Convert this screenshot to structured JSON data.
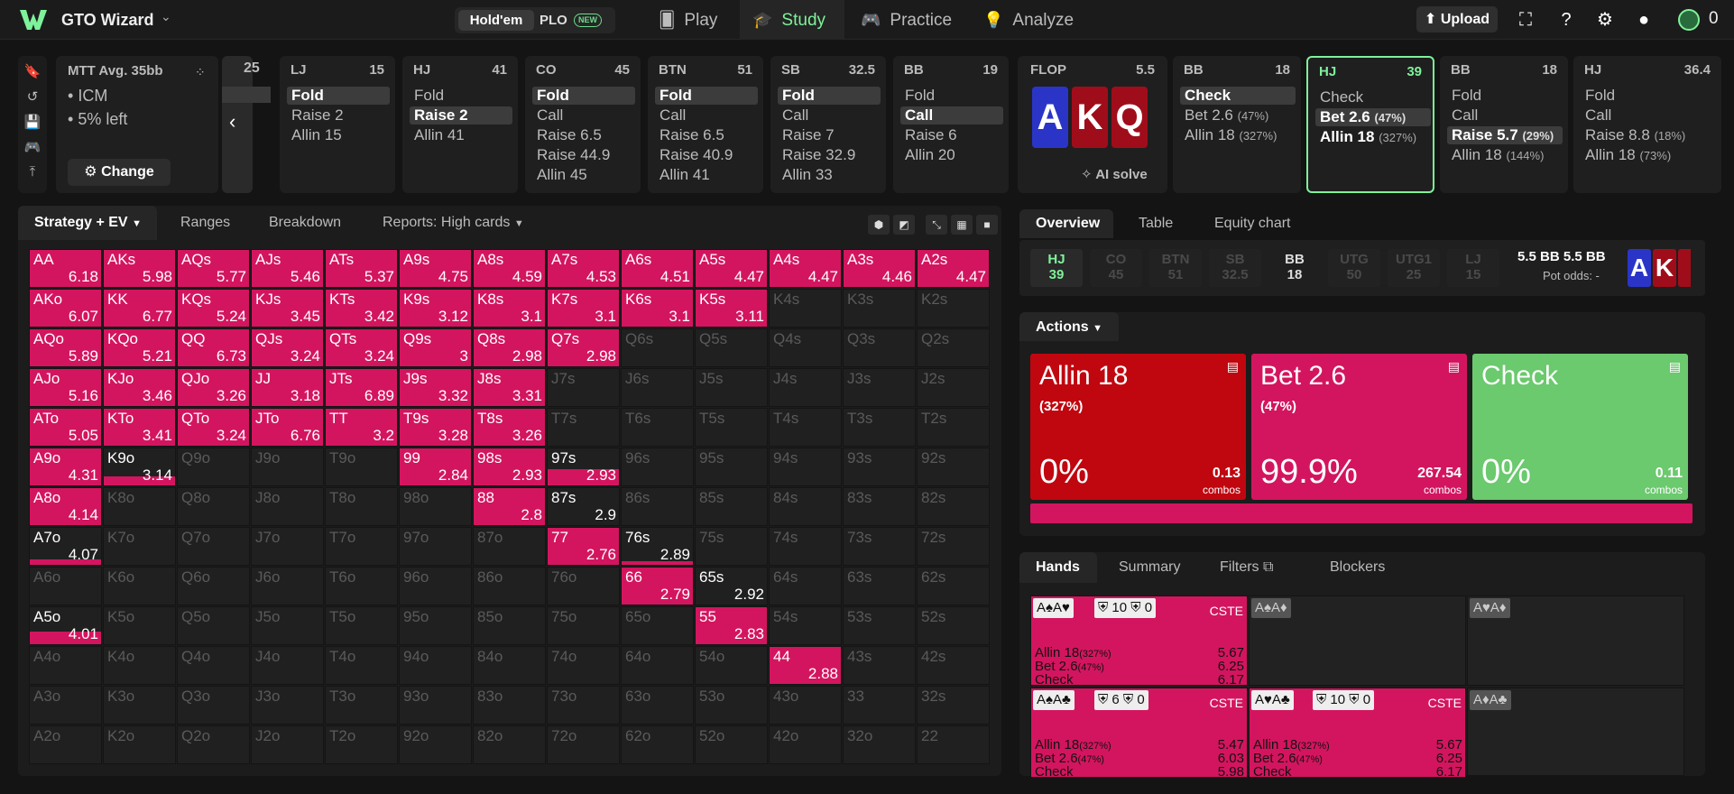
{
  "nav": {
    "brand": "GTO Wizard",
    "holdem": "Hold'em",
    "plo": "PLO",
    "new_badge": "NEW",
    "play": "Play",
    "study": "Study",
    "practice": "Practice",
    "analyze": "Analyze",
    "upload": "Upload",
    "credits": "0"
  },
  "mtt": {
    "title": "MTT  Avg. 35bb",
    "icm": "ICM",
    "left": "5% left",
    "change": "Change"
  },
  "prev": {
    "stack": "25"
  },
  "positions": [
    {
      "pos": "LJ",
      "stack": "15",
      "opts": [
        {
          "t": "Fold",
          "sel": true
        },
        {
          "t": "Raise 2"
        },
        {
          "t": "Allin 15"
        }
      ]
    },
    {
      "pos": "HJ",
      "stack": "41",
      "opts": [
        {
          "t": "Fold"
        },
        {
          "t": "Raise 2",
          "sel": true
        },
        {
          "t": "Allin 41"
        }
      ]
    },
    {
      "pos": "CO",
      "stack": "45",
      "opts": [
        {
          "t": "Fold",
          "sel": true
        },
        {
          "t": "Call"
        },
        {
          "t": "Raise 6.5"
        },
        {
          "t": "Raise 44.9"
        },
        {
          "t": "Allin 45"
        }
      ]
    },
    {
      "pos": "BTN",
      "stack": "51",
      "opts": [
        {
          "t": "Fold",
          "sel": true
        },
        {
          "t": "Call"
        },
        {
          "t": "Raise 6.5"
        },
        {
          "t": "Raise 40.9"
        },
        {
          "t": "Allin 41"
        }
      ]
    },
    {
      "pos": "SB",
      "stack": "32.5",
      "opts": [
        {
          "t": "Fold",
          "sel": true
        },
        {
          "t": "Call"
        },
        {
          "t": "Raise 7"
        },
        {
          "t": "Raise 32.9"
        },
        {
          "t": "Allin 33"
        }
      ]
    },
    {
      "pos": "BB",
      "stack": "19",
      "opts": [
        {
          "t": "Fold"
        },
        {
          "t": "Call",
          "sel": true
        },
        {
          "t": "Raise 6"
        },
        {
          "t": "Allin 20"
        }
      ]
    }
  ],
  "flop": {
    "label": "FLOP",
    "pot": "5.5",
    "cards": [
      "A",
      "K",
      "Q"
    ],
    "ai": "AI solve"
  },
  "postflop": [
    {
      "pos": "BB",
      "stack": "18",
      "opts": [
        {
          "t": "Check",
          "sel": true
        },
        {
          "t": "Bet 2.6",
          "p": "(47%)"
        },
        {
          "t": "Allin 18",
          "p": "(327%)"
        }
      ]
    },
    {
      "pos": "HJ",
      "stack": "39",
      "active": true,
      "opts": [
        {
          "t": "Check"
        },
        {
          "t": "Bet 2.6",
          "p": "(47%)",
          "sel": true
        },
        {
          "t": "Allin 18",
          "p": "(327%)",
          "bold": true
        }
      ]
    },
    {
      "pos": "BB",
      "stack": "18",
      "opts": [
        {
          "t": "Fold"
        },
        {
          "t": "Call"
        },
        {
          "t": "Raise 5.7",
          "p": "(29%)",
          "sel": true
        },
        {
          "t": "Allin 18",
          "p": "(144%)"
        }
      ]
    },
    {
      "pos": "HJ",
      "stack": "36.4",
      "opts": [
        {
          "t": "Fold"
        },
        {
          "t": "Call"
        },
        {
          "t": "Raise 8.8",
          "p": "(18%)"
        },
        {
          "t": "Allin 18",
          "p": "(73%)"
        }
      ]
    }
  ],
  "strategy_tabs": {
    "se": "Strategy + EV",
    "ranges": "Ranges",
    "breakdown": "Breakdown",
    "reports": "Reports: High cards"
  },
  "grid": [
    [
      [
        "AA",
        6.18,
        1
      ],
      [
        "AKs",
        5.98,
        1
      ],
      [
        "AQs",
        5.77,
        1
      ],
      [
        "AJs",
        5.46,
        1
      ],
      [
        "ATs",
        5.37,
        1
      ],
      [
        "A9s",
        4.75,
        1
      ],
      [
        "A8s",
        4.59,
        1
      ],
      [
        "A7s",
        4.53,
        1
      ],
      [
        "A6s",
        4.51,
        1
      ],
      [
        "A5s",
        4.47,
        1
      ],
      [
        "A4s",
        4.47,
        1
      ],
      [
        "A3s",
        4.46,
        1
      ],
      [
        "A2s",
        4.47,
        1
      ]
    ],
    [
      [
        "AKo",
        6.07,
        1
      ],
      [
        "KK",
        6.77,
        1
      ],
      [
        "KQs",
        5.24,
        1
      ],
      [
        "KJs",
        3.45,
        1
      ],
      [
        "KTs",
        3.42,
        1
      ],
      [
        "K9s",
        3.12,
        1
      ],
      [
        "K8s",
        3.1,
        1
      ],
      [
        "K7s",
        3.1,
        1
      ],
      [
        "K6s",
        3.1,
        1
      ],
      [
        "K5s",
        3.11,
        1
      ],
      [
        "K4s",
        null,
        0
      ],
      [
        "K3s",
        null,
        0
      ],
      [
        "K2s",
        null,
        0
      ]
    ],
    [
      [
        "AQo",
        5.89,
        1
      ],
      [
        "KQo",
        5.21,
        1
      ],
      [
        "QQ",
        6.73,
        1
      ],
      [
        "QJs",
        3.24,
        1
      ],
      [
        "QTs",
        3.24,
        1
      ],
      [
        "Q9s",
        3,
        1
      ],
      [
        "Q8s",
        2.98,
        1
      ],
      [
        "Q7s",
        2.98,
        1
      ],
      [
        "Q6s",
        null,
        0
      ],
      [
        "Q5s",
        null,
        0
      ],
      [
        "Q4s",
        null,
        0
      ],
      [
        "Q3s",
        null,
        0
      ],
      [
        "Q2s",
        null,
        0
      ]
    ],
    [
      [
        "AJo",
        5.16,
        1
      ],
      [
        "KJo",
        3.46,
        1
      ],
      [
        "QJo",
        3.26,
        1
      ],
      [
        "JJ",
        3.18,
        1
      ],
      [
        "JTs",
        6.89,
        1
      ],
      [
        "J9s",
        3.32,
        1
      ],
      [
        "J8s",
        3.31,
        1
      ],
      [
        "J7s",
        null,
        0
      ],
      [
        "J6s",
        null,
        0
      ],
      [
        "J5s",
        null,
        0
      ],
      [
        "J4s",
        null,
        0
      ],
      [
        "J3s",
        null,
        0
      ],
      [
        "J2s",
        null,
        0
      ]
    ],
    [
      [
        "ATo",
        5.05,
        1
      ],
      [
        "KTo",
        3.41,
        1
      ],
      [
        "QTo",
        3.24,
        1
      ],
      [
        "JTo",
        6.76,
        1
      ],
      [
        "TT",
        3.2,
        1
      ],
      [
        "T9s",
        3.28,
        1
      ],
      [
        "T8s",
        3.26,
        1
      ],
      [
        "T7s",
        null,
        0
      ],
      [
        "T6s",
        null,
        0
      ],
      [
        "T5s",
        null,
        0
      ],
      [
        "T4s",
        null,
        0
      ],
      [
        "T3s",
        null,
        0
      ],
      [
        "T2s",
        null,
        0
      ]
    ],
    [
      [
        "A9o",
        4.31,
        1
      ],
      [
        "K9o",
        3.14,
        0.25
      ],
      [
        "Q9o",
        null,
        0
      ],
      [
        "J9o",
        null,
        0
      ],
      [
        "T9o",
        null,
        0
      ],
      [
        "99",
        2.84,
        1
      ],
      [
        "98s",
        2.93,
        1
      ],
      [
        "97s",
        2.93,
        0.45
      ],
      [
        "96s",
        null,
        0
      ],
      [
        "95s",
        null,
        0
      ],
      [
        "94s",
        null,
        0
      ],
      [
        "93s",
        null,
        0
      ],
      [
        "92s",
        null,
        0
      ]
    ],
    [
      [
        "A8o",
        4.14,
        1
      ],
      [
        "K8o",
        null,
        0
      ],
      [
        "Q8o",
        null,
        0
      ],
      [
        "J8o",
        null,
        0
      ],
      [
        "T8o",
        null,
        0
      ],
      [
        "98o",
        null,
        0
      ],
      [
        "88",
        2.8,
        1
      ],
      [
        "87s",
        2.9,
        0
      ],
      [
        "86s",
        null,
        0
      ],
      [
        "85s",
        null,
        0
      ],
      [
        "84s",
        null,
        0
      ],
      [
        "83s",
        null,
        0
      ],
      [
        "82s",
        null,
        0
      ]
    ],
    [
      [
        "A7o",
        4.07,
        0.15
      ],
      [
        "K7o",
        null,
        0
      ],
      [
        "Q7o",
        null,
        0
      ],
      [
        "J7o",
        null,
        0
      ],
      [
        "T7o",
        null,
        0
      ],
      [
        "97o",
        null,
        0
      ],
      [
        "87o",
        null,
        0
      ],
      [
        "77",
        2.76,
        1
      ],
      [
        "76s",
        2.89,
        0.1
      ],
      [
        "75s",
        null,
        0
      ],
      [
        "74s",
        null,
        0
      ],
      [
        "73s",
        null,
        0
      ],
      [
        "72s",
        null,
        0
      ]
    ],
    [
      [
        "A6o",
        null,
        0
      ],
      [
        "K6o",
        null,
        0
      ],
      [
        "Q6o",
        null,
        0
      ],
      [
        "J6o",
        null,
        0
      ],
      [
        "T6o",
        null,
        0
      ],
      [
        "96o",
        null,
        0
      ],
      [
        "86o",
        null,
        0
      ],
      [
        "76o",
        null,
        0
      ],
      [
        "66",
        2.79,
        1
      ],
      [
        "65s",
        2.92,
        0
      ],
      [
        "64s",
        null,
        0
      ],
      [
        "63s",
        null,
        0
      ],
      [
        "62s",
        null,
        0
      ]
    ],
    [
      [
        "A5o",
        4.01,
        0.35
      ],
      [
        "K5o",
        null,
        0
      ],
      [
        "Q5o",
        null,
        0
      ],
      [
        "J5o",
        null,
        0
      ],
      [
        "T5o",
        null,
        0
      ],
      [
        "95o",
        null,
        0
      ],
      [
        "85o",
        null,
        0
      ],
      [
        "75o",
        null,
        0
      ],
      [
        "65o",
        null,
        0
      ],
      [
        "55",
        2.83,
        1
      ],
      [
        "54s",
        null,
        0
      ],
      [
        "53s",
        null,
        0
      ],
      [
        "52s",
        null,
        0
      ]
    ],
    [
      [
        "A4o",
        null,
        0
      ],
      [
        "K4o",
        null,
        0
      ],
      [
        "Q4o",
        null,
        0
      ],
      [
        "J4o",
        null,
        0
      ],
      [
        "T4o",
        null,
        0
      ],
      [
        "94o",
        null,
        0
      ],
      [
        "84o",
        null,
        0
      ],
      [
        "74o",
        null,
        0
      ],
      [
        "64o",
        null,
        0
      ],
      [
        "54o",
        null,
        0
      ],
      [
        "44",
        2.88,
        1
      ],
      [
        "43s",
        null,
        0
      ],
      [
        "42s",
        null,
        0
      ]
    ],
    [
      [
        "A3o",
        null,
        0
      ],
      [
        "K3o",
        null,
        0
      ],
      [
        "Q3o",
        null,
        0
      ],
      [
        "J3o",
        null,
        0
      ],
      [
        "T3o",
        null,
        0
      ],
      [
        "93o",
        null,
        0
      ],
      [
        "83o",
        null,
        0
      ],
      [
        "73o",
        null,
        0
      ],
      [
        "63o",
        null,
        0
      ],
      [
        "53o",
        null,
        0
      ],
      [
        "43o",
        null,
        0
      ],
      [
        "33",
        null,
        0
      ],
      [
        "32s",
        null,
        0
      ]
    ],
    [
      [
        "A2o",
        null,
        0
      ],
      [
        "K2o",
        null,
        0
      ],
      [
        "Q2o",
        null,
        0
      ],
      [
        "J2o",
        null,
        0
      ],
      [
        "T2o",
        null,
        0
      ],
      [
        "92o",
        null,
        0
      ],
      [
        "82o",
        null,
        0
      ],
      [
        "72o",
        null,
        0
      ],
      [
        "62o",
        null,
        0
      ],
      [
        "52o",
        null,
        0
      ],
      [
        "42o",
        null,
        0
      ],
      [
        "32o",
        null,
        0
      ],
      [
        "22",
        null,
        0
      ]
    ]
  ],
  "overview": {
    "tabs": [
      "Overview",
      "Table",
      "Equity chart"
    ],
    "strip": [
      {
        "pos": "HJ",
        "stack": "39",
        "state": "hj"
      },
      {
        "pos": "CO",
        "stack": "45",
        "state": "off"
      },
      {
        "pos": "BTN",
        "stack": "51",
        "state": "off"
      },
      {
        "pos": "SB",
        "stack": "32.5",
        "state": "off"
      },
      {
        "pos": "BB",
        "stack": "18",
        "state": "bb"
      },
      {
        "pos": "UTG",
        "stack": "50",
        "state": "off"
      },
      {
        "pos": "UTG1",
        "stack": "25",
        "state": "off"
      },
      {
        "pos": "LJ",
        "stack": "15",
        "state": "off"
      }
    ],
    "pot": "5.5 BB  5.5 BB",
    "pot_odds": "Pot odds:  -"
  },
  "actions": {
    "title": "Actions",
    "boxes": [
      {
        "name": "Allin 18",
        "pct": "(327%)",
        "freq": "0%",
        "combos": "0.13",
        "combos_label": "combos",
        "color": "#c0060f"
      },
      {
        "name": "Bet 2.6",
        "pct": "(47%)",
        "freq": "99.9%",
        "combos": "267.54",
        "combos_label": "combos",
        "color": "#d3155f"
      },
      {
        "name": "Check",
        "pct": "",
        "freq": "0%",
        "combos": "0.11",
        "combos_label": "combos",
        "color": "#6bc96e"
      }
    ]
  },
  "hands": {
    "tabs": [
      "Hands",
      "Summary",
      "Filters",
      "Blockers"
    ],
    "cste": "CSTE",
    "rows": [
      {
        "combo": "A♠A♥",
        "b1": "10",
        "b2": "0",
        "pink": true,
        "lines": [
          [
            "Allin 18",
            "(327%)",
            "5.67"
          ],
          [
            "Bet 2.6",
            "(47%)",
            "6.25"
          ],
          [
            "Check",
            "",
            "6.17"
          ]
        ]
      },
      {
        "combo": "A♠A♦",
        "pink": false
      },
      {
        "combo": "A♥A♦",
        "pink": false
      },
      {
        "combo": "A♠A♣",
        "b1": "6",
        "b2": "0",
        "pink": true,
        "lines": [
          [
            "Allin 18",
            "(327%)",
            "5.47"
          ],
          [
            "Bet 2.6",
            "(47%)",
            "6.03"
          ],
          [
            "Check",
            "",
            "5.98"
          ]
        ]
      },
      {
        "combo": "A♥A♣",
        "b1": "10",
        "b2": "0",
        "pink": true,
        "lines": [
          [
            "Allin 18",
            "(327%)",
            "5.67"
          ],
          [
            "Bet 2.6",
            "(47%)",
            "6.25"
          ],
          [
            "Check",
            "",
            "6.17"
          ]
        ]
      },
      {
        "combo": "A♦A♣",
        "pink": false
      }
    ]
  }
}
